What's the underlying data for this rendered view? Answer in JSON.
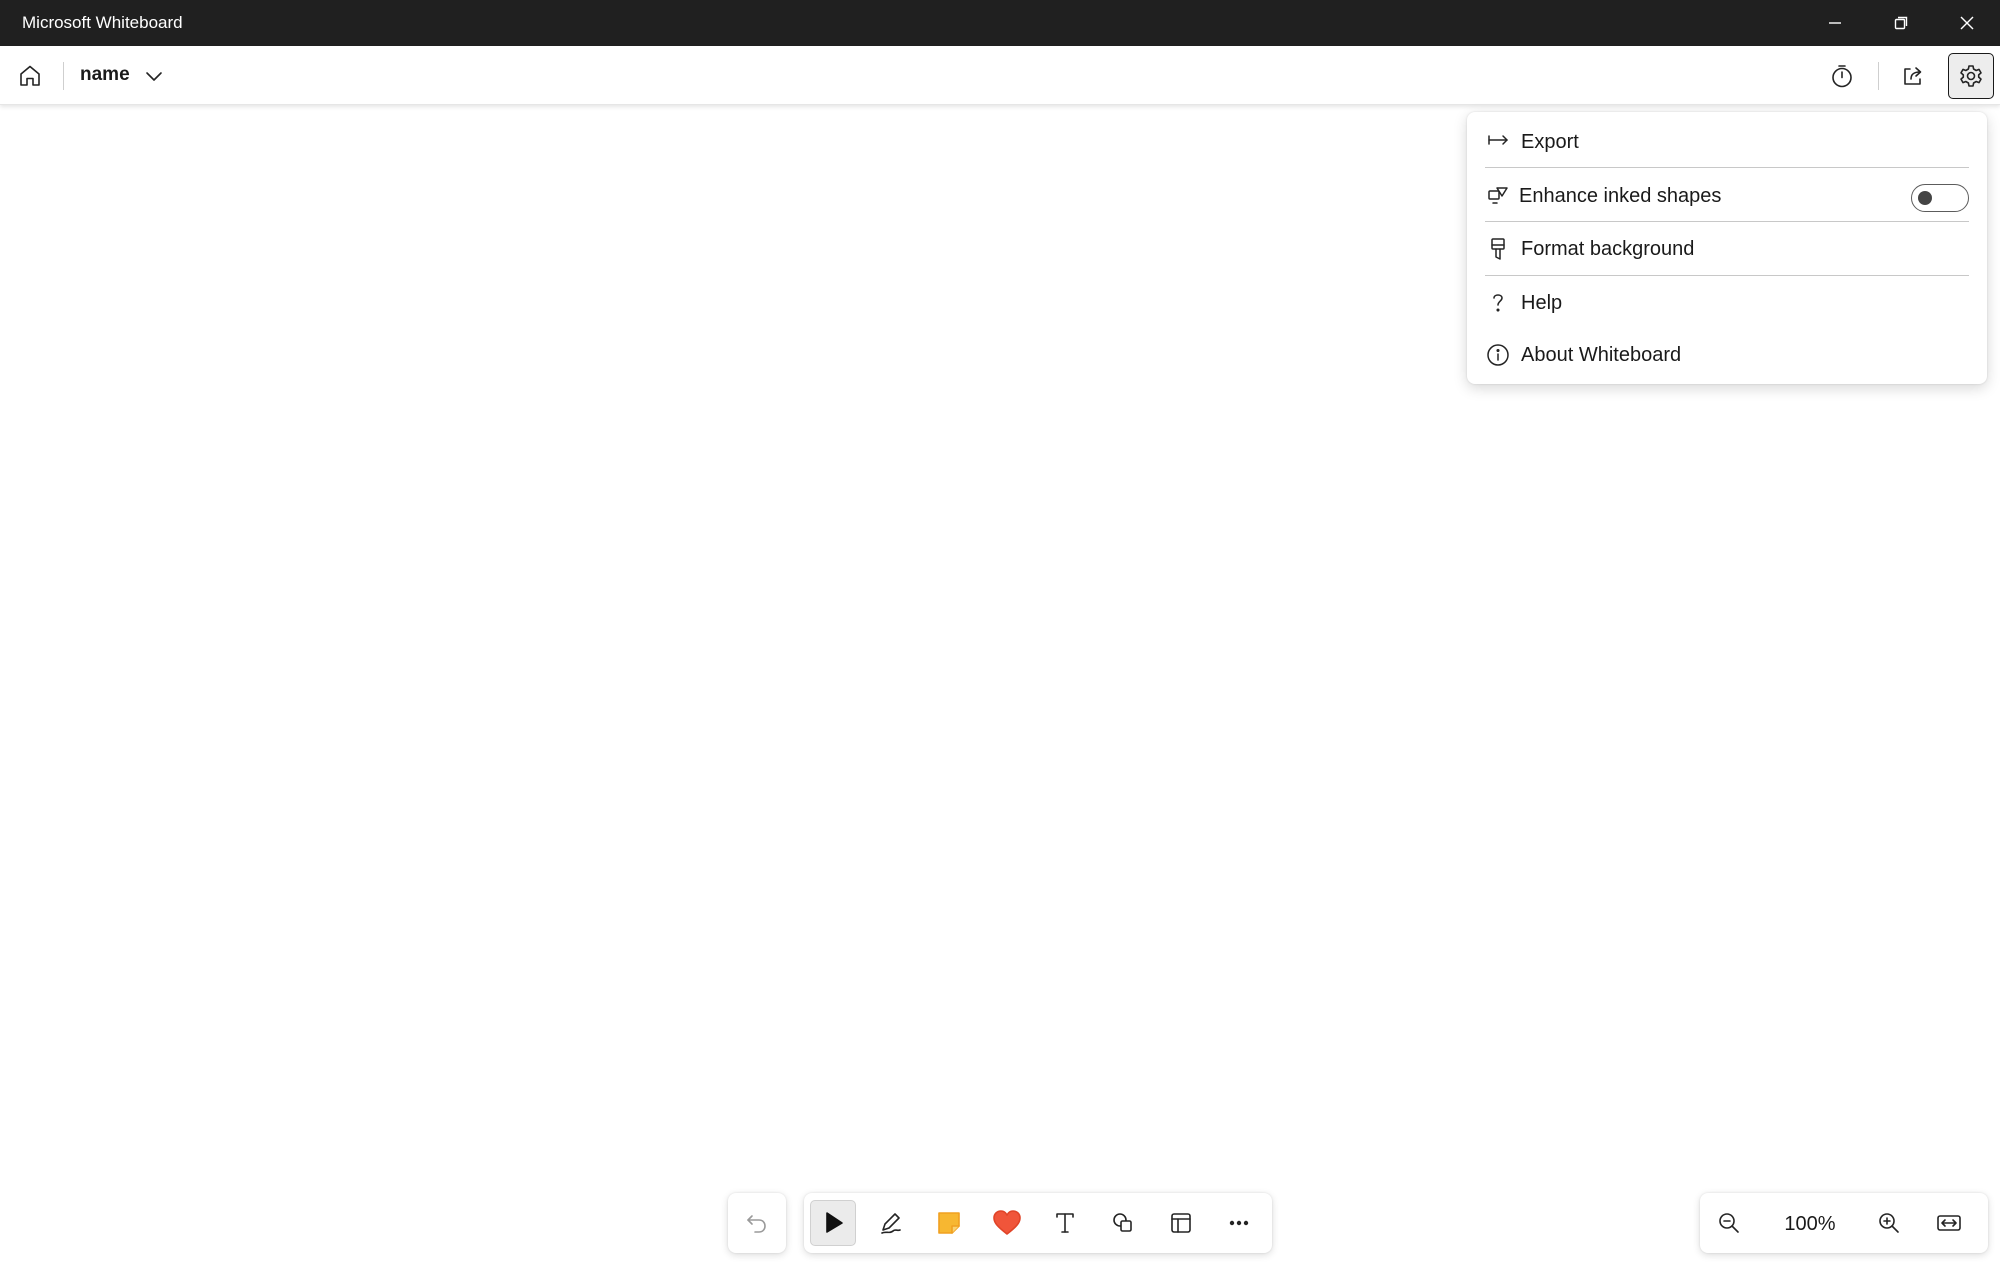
{
  "window": {
    "title": "Microsoft Whiteboard"
  },
  "appbar": {
    "board_name": "name"
  },
  "settings_menu": {
    "items": [
      {
        "label": "Export",
        "icon": "export-icon"
      },
      {
        "label": "Enhance inked shapes",
        "icon": "enhance-shapes-icon",
        "toggle": false
      },
      {
        "label": "Format background",
        "icon": "format-background-icon"
      },
      {
        "label": "Help",
        "icon": "help-icon"
      },
      {
        "label": "About Whiteboard",
        "icon": "info-icon"
      }
    ]
  },
  "toolbar": {
    "tools": [
      "undo-icon",
      "select-icon",
      "pen-icon",
      "sticky-note-icon",
      "reactions-icon",
      "text-icon",
      "shapes-icon",
      "templates-icon",
      "more-icon"
    ],
    "selected_tool": "select-icon"
  },
  "zoom": {
    "level": "100%"
  },
  "colors": {
    "titlebar": "#202020",
    "sticky_note": "#f7b731",
    "heart": "#f0553a"
  }
}
